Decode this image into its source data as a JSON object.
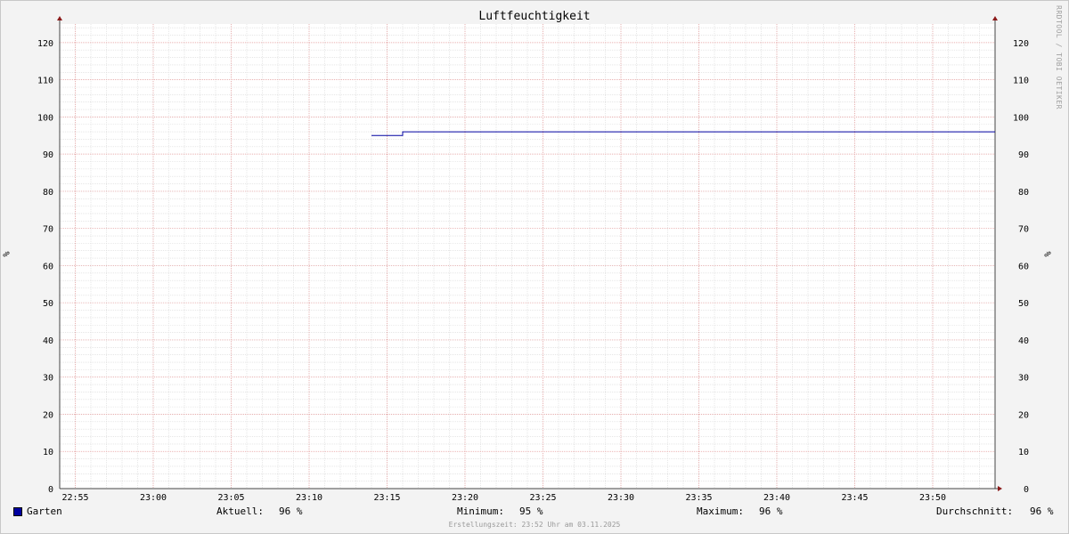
{
  "chart_data": {
    "type": "line",
    "title": "Luftfeuchtigkeit",
    "ylabel": "%",
    "ylabel_right": "%",
    "ylim": [
      0,
      125
    ],
    "yticks": [
      0,
      10,
      20,
      30,
      40,
      50,
      60,
      70,
      80,
      90,
      100,
      110,
      120
    ],
    "xlim": [
      "22:54",
      "23:54"
    ],
    "xticks": [
      "22:55",
      "23:00",
      "23:05",
      "23:10",
      "23:15",
      "23:20",
      "23:25",
      "23:30",
      "23:35",
      "23:40",
      "23:45",
      "23:50"
    ],
    "grid": true,
    "series": [
      {
        "name": "Garten",
        "color": "#0000a0",
        "x": [
          "23:14",
          "23:16",
          "23:16",
          "23:54"
        ],
        "y": [
          95,
          95,
          96,
          96
        ]
      }
    ]
  },
  "legend": {
    "series_name": "Garten",
    "aktuell_label": "Aktuell:",
    "aktuell_value": "96 %",
    "minimum_label": "Minimum:",
    "minimum_value": "95 %",
    "maximum_label": "Maximum:",
    "maximum_value": "96 %",
    "durchschnitt_label": "Durchschnitt:",
    "durchschnitt_value": "96 %"
  },
  "footer": {
    "created": "Erstellungszeit: 23:52 Uhr am 03.11.2025"
  },
  "watermark": "RRDTOOL / TOBI OETIKER"
}
